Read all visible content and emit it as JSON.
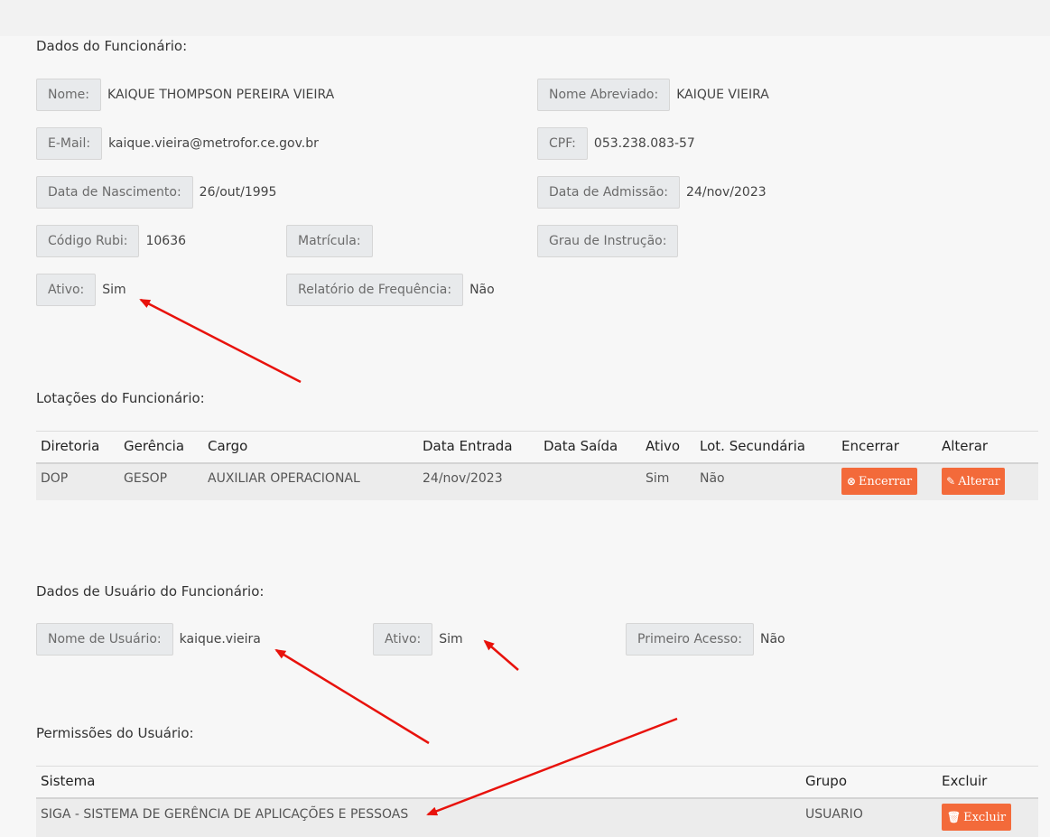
{
  "sections": {
    "employee": "Dados do Funcionário:",
    "lotacoes": "Lotações do Funcionário:",
    "user": "Dados de Usuário do Funcionário:",
    "permissions": "Permissões do Usuário:"
  },
  "employee": {
    "nome": {
      "label": "Nome:",
      "value": "KAIQUE THOMPSON PEREIRA VIEIRA"
    },
    "nome_abreviado": {
      "label": "Nome Abreviado:",
      "value": "KAIQUE VIEIRA"
    },
    "email": {
      "label": "E-Mail:",
      "value": "kaique.vieira@metrofor.ce.gov.br"
    },
    "cpf": {
      "label": "CPF:",
      "value": "053.238.083-57"
    },
    "nascimento": {
      "label": "Data de Nascimento:",
      "value": "26/out/1995"
    },
    "admissao": {
      "label": "Data de Admissão:",
      "value": "24/nov/2023"
    },
    "rubi": {
      "label": "Código Rubi:",
      "value": "10636"
    },
    "matricula": {
      "label": "Matrícula:",
      "value": ""
    },
    "instrucao": {
      "label": "Grau de Instrução:",
      "value": ""
    },
    "ativo": {
      "label": "Ativo:",
      "value": "Sim"
    },
    "frequencia": {
      "label": "Relatório de Frequência:",
      "value": "Não"
    }
  },
  "lotacoes": {
    "headers": [
      "Diretoria",
      "Gerência",
      "Cargo",
      "Data Entrada",
      "Data Saída",
      "Ativo",
      "Lot. Secundária",
      "Encerrar",
      "Alterar"
    ],
    "rows": [
      {
        "diretoria": "DOP",
        "gerencia": "GESOP",
        "cargo": "AUXILIAR OPERACIONAL",
        "entrada": "24/nov/2023",
        "saida": "",
        "ativo": "Sim",
        "secundaria": "Não",
        "encerrar": "Encerrar",
        "alterar": "Alterar"
      }
    ]
  },
  "user": {
    "nome_usuario": {
      "label": "Nome de Usuário:",
      "value": "kaique.vieira"
    },
    "ativo": {
      "label": "Ativo:",
      "value": "Sim"
    },
    "primeiro_acesso": {
      "label": "Primeiro Acesso:",
      "value": "Não"
    }
  },
  "permissions": {
    "headers": [
      "Sistema",
      "Grupo",
      "Excluir"
    ],
    "rows": [
      {
        "sistema": "SIGA - SISTEMA DE GERÊNCIA DE APLICAÇÕES E PESSOAS",
        "grupo": "USUARIO",
        "excluir": "Excluir"
      }
    ]
  },
  "colors": {
    "accent_button": "#f36a3a",
    "annotation_arrow": "#e8120c"
  }
}
